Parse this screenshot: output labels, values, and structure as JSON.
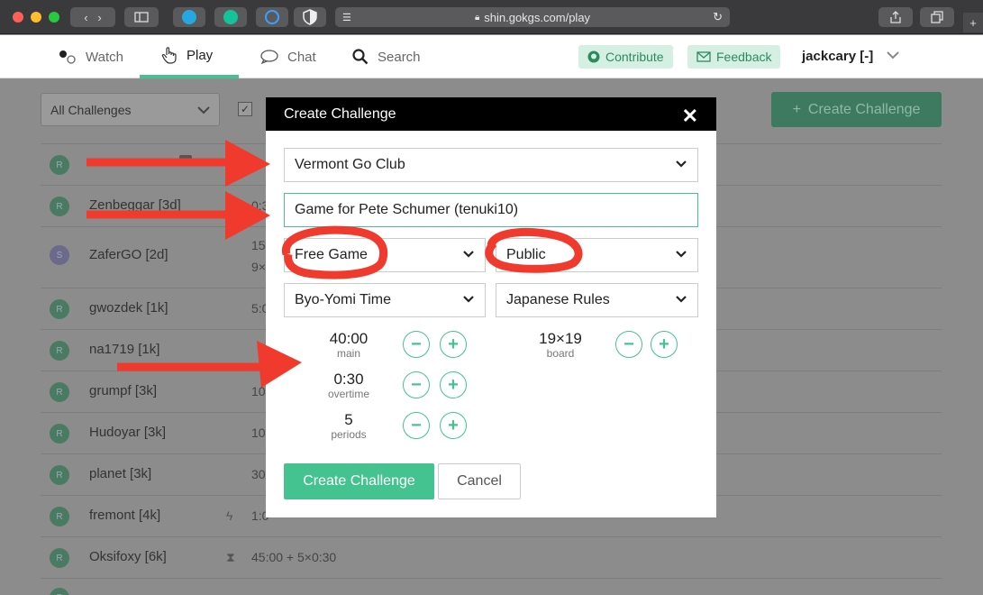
{
  "browser": {
    "url": "shin.gokgs.com/play"
  },
  "nav": {
    "watch": "Watch",
    "play": "Play",
    "chat": "Chat",
    "search": "Search",
    "contribute": "Contribute",
    "feedback": "Feedback",
    "user": "jackcary [-]",
    "accent": "#44c28f"
  },
  "background": {
    "filter": "All Challenges",
    "create_button": "Create Challenge",
    "rows": [
      {
        "avatar": "R",
        "name": "Zenbeggar [3d]",
        "time": "0:3"
      },
      {
        "avatar": "S",
        "name": "ZaferGO [2d]",
        "time": "15",
        "time2": "9×"
      },
      {
        "avatar": "R",
        "name": "gwozdek [1k]",
        "time": "5:0"
      },
      {
        "avatar": "R",
        "name": "na1719 [1k]",
        "time": ""
      },
      {
        "avatar": "R",
        "name": "grumpf [3k]",
        "time": "10"
      },
      {
        "avatar": "R",
        "name": "Hudoyar [3k]",
        "time": "10"
      },
      {
        "avatar": "R",
        "name": "planet [3k]",
        "time": "30"
      },
      {
        "avatar": "R",
        "name": "fremont [4k]",
        "time": "1:0"
      },
      {
        "avatar": "R",
        "name": "Oksifoxy [6k]",
        "time": "45:00 + 5×0:30"
      }
    ]
  },
  "modal": {
    "title": "Create Challenge",
    "club_select": "Vermont Go Club",
    "game_name": "Game for Pete Schumer (tenuki10)",
    "game_type": "Free Game",
    "visibility": "Public",
    "time_system": "Byo-Yomi Time",
    "rules": "Japanese Rules",
    "main_time": {
      "value": "40:00",
      "label": "main"
    },
    "overtime": {
      "value": "0:30",
      "label": "overtime"
    },
    "periods": {
      "value": "5",
      "label": "periods"
    },
    "board": {
      "value": "19×19",
      "label": "board"
    },
    "create_button": "Create Challenge",
    "cancel_button": "Cancel"
  },
  "annotation_color": "#f03a2e"
}
